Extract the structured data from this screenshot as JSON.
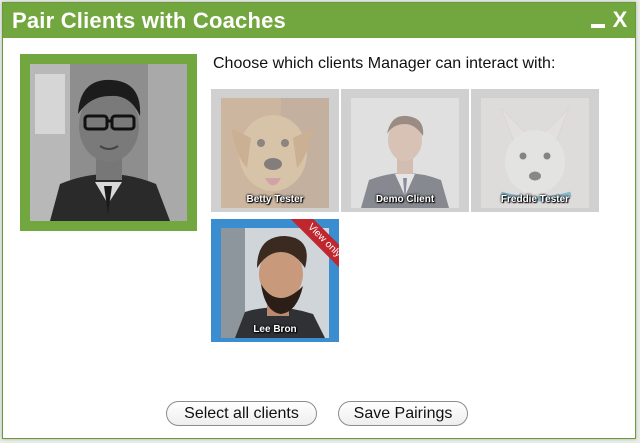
{
  "dialog": {
    "title": "Pair Clients with Coaches",
    "minimize_icon": "minimize-icon",
    "close_label": "X",
    "accent_color": "#72a63e"
  },
  "coach": {
    "photo_icon": "coach-portrait"
  },
  "instruction": "Choose which clients Manager can interact with:",
  "clients": [
    {
      "name": "Betty Tester",
      "selected": false,
      "photo": "dog-golden-retriever"
    },
    {
      "name": "Demo Client",
      "selected": false,
      "photo": "man-in-suit"
    },
    {
      "name": "Freddie Tester",
      "selected": false,
      "photo": "white-dog"
    },
    {
      "name": "Lee Bron",
      "selected": true,
      "badge": "View only",
      "photo": "bearded-man"
    }
  ],
  "buttons": {
    "select_all": "Select all clients",
    "save": "Save Pairings"
  },
  "colors": {
    "selected_border": "#3a8ed0",
    "unselected_border": "#d0d0d0",
    "badge": "#c0262e"
  }
}
